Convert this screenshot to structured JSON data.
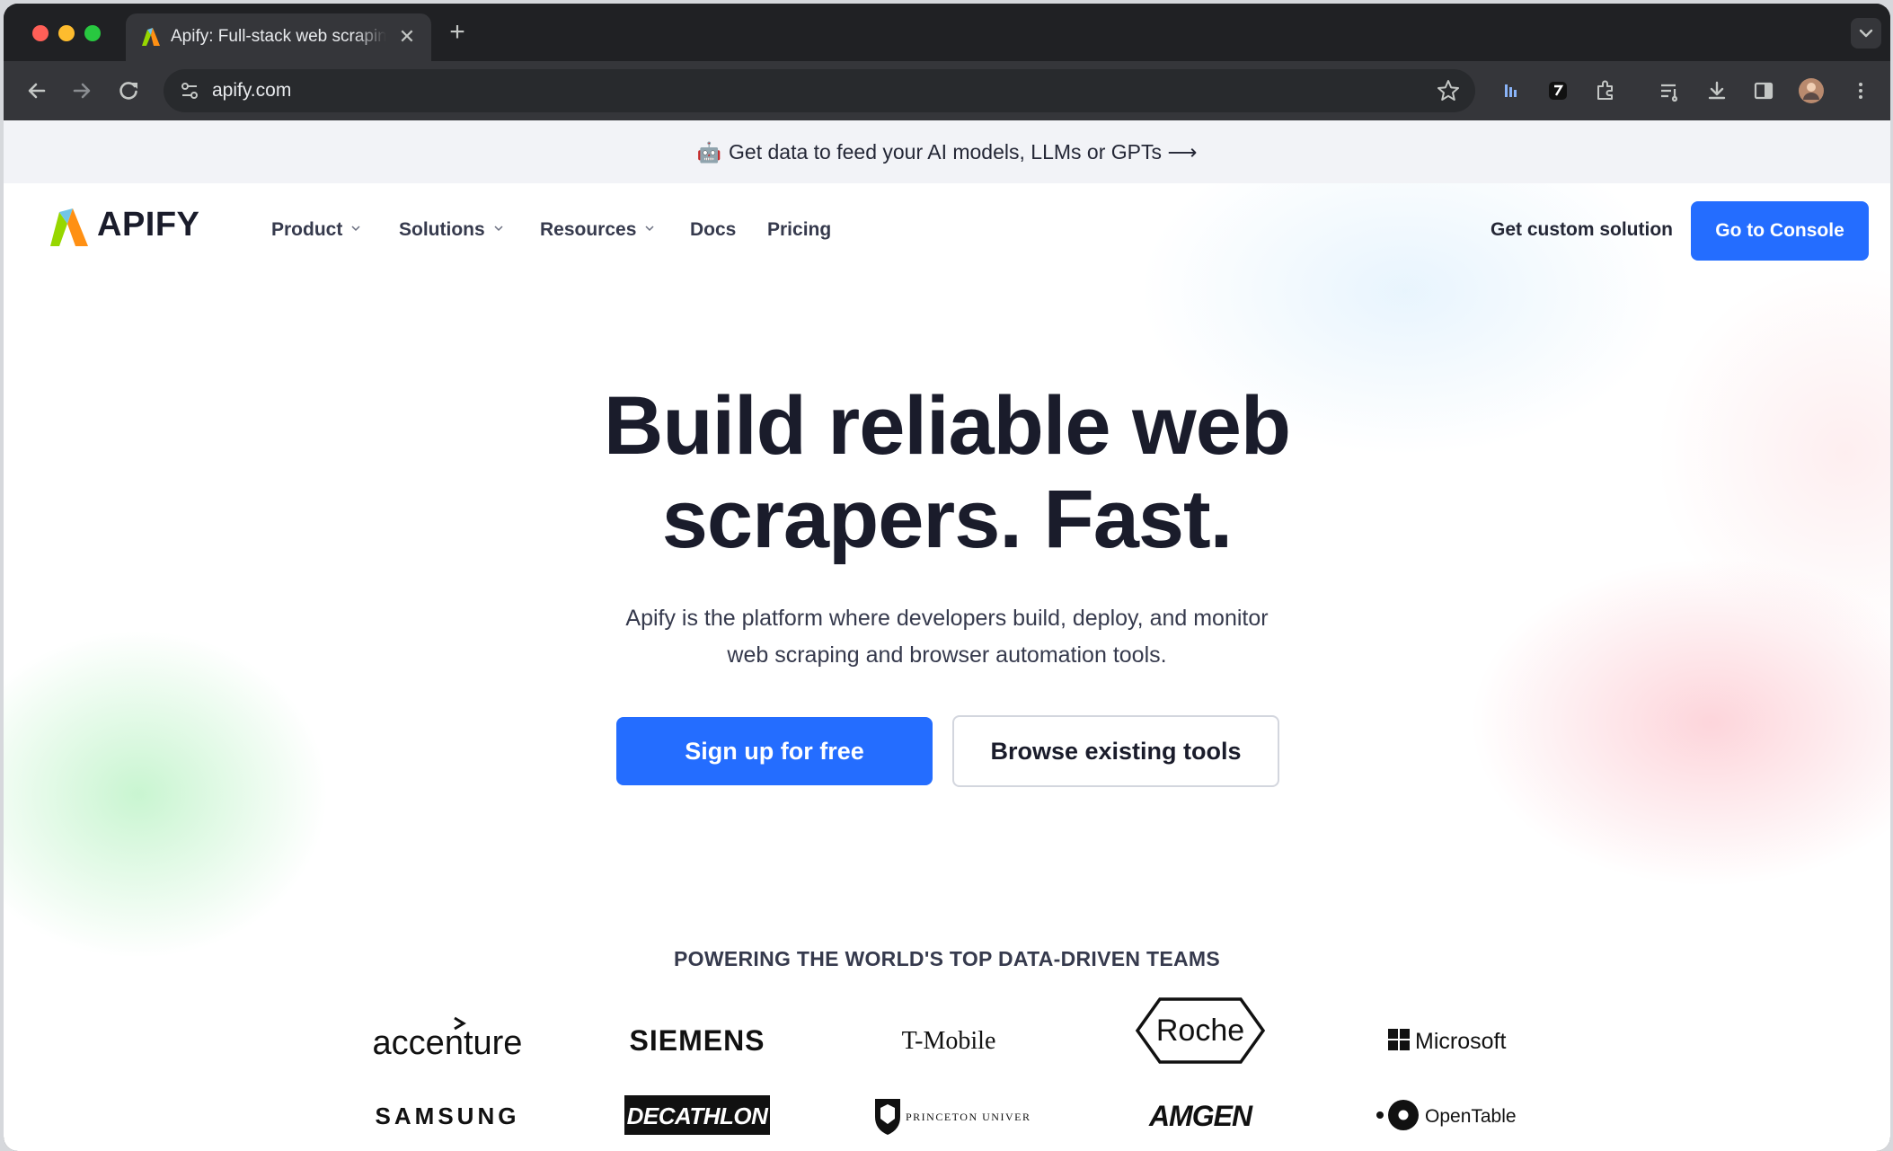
{
  "browser": {
    "tab_title": "Apify: Full-stack web scraping and data extraction platform",
    "url": "apify.com"
  },
  "announcement": {
    "text": "Get data to feed your AI models, LLMs or GPTs ⟶"
  },
  "nav": {
    "logo_text": "APIFY",
    "items": [
      {
        "label": "Product",
        "dropdown": true
      },
      {
        "label": "Solutions",
        "dropdown": true
      },
      {
        "label": "Resources",
        "dropdown": true
      },
      {
        "label": "Docs",
        "dropdown": false
      },
      {
        "label": "Pricing",
        "dropdown": false
      }
    ],
    "custom_solution": "Get custom solution",
    "console_button": "Go to Console"
  },
  "hero": {
    "title_line1": "Build reliable web",
    "title_line2": "scrapers. Fast.",
    "subtitle_line1": "Apify is the platform where developers build, deploy, and monitor",
    "subtitle_line2": "web scraping and browser automation tools.",
    "primary_cta": "Sign up for free",
    "secondary_cta": "Browse existing tools"
  },
  "customers": {
    "heading": "POWERING THE WORLD'S TOP DATA-DRIVEN TEAMS",
    "logos": [
      "accenture",
      "SIEMENS",
      "T-Mobile",
      "Roche",
      "Microsoft",
      "SAMSUNG",
      "DECATHLON",
      "PRINCETON UNIVERSITY",
      "AMGEN",
      "OpenTable"
    ]
  },
  "colors": {
    "accent": "#246dff",
    "heading": "#1a1c2b",
    "body": "#363a4d"
  }
}
